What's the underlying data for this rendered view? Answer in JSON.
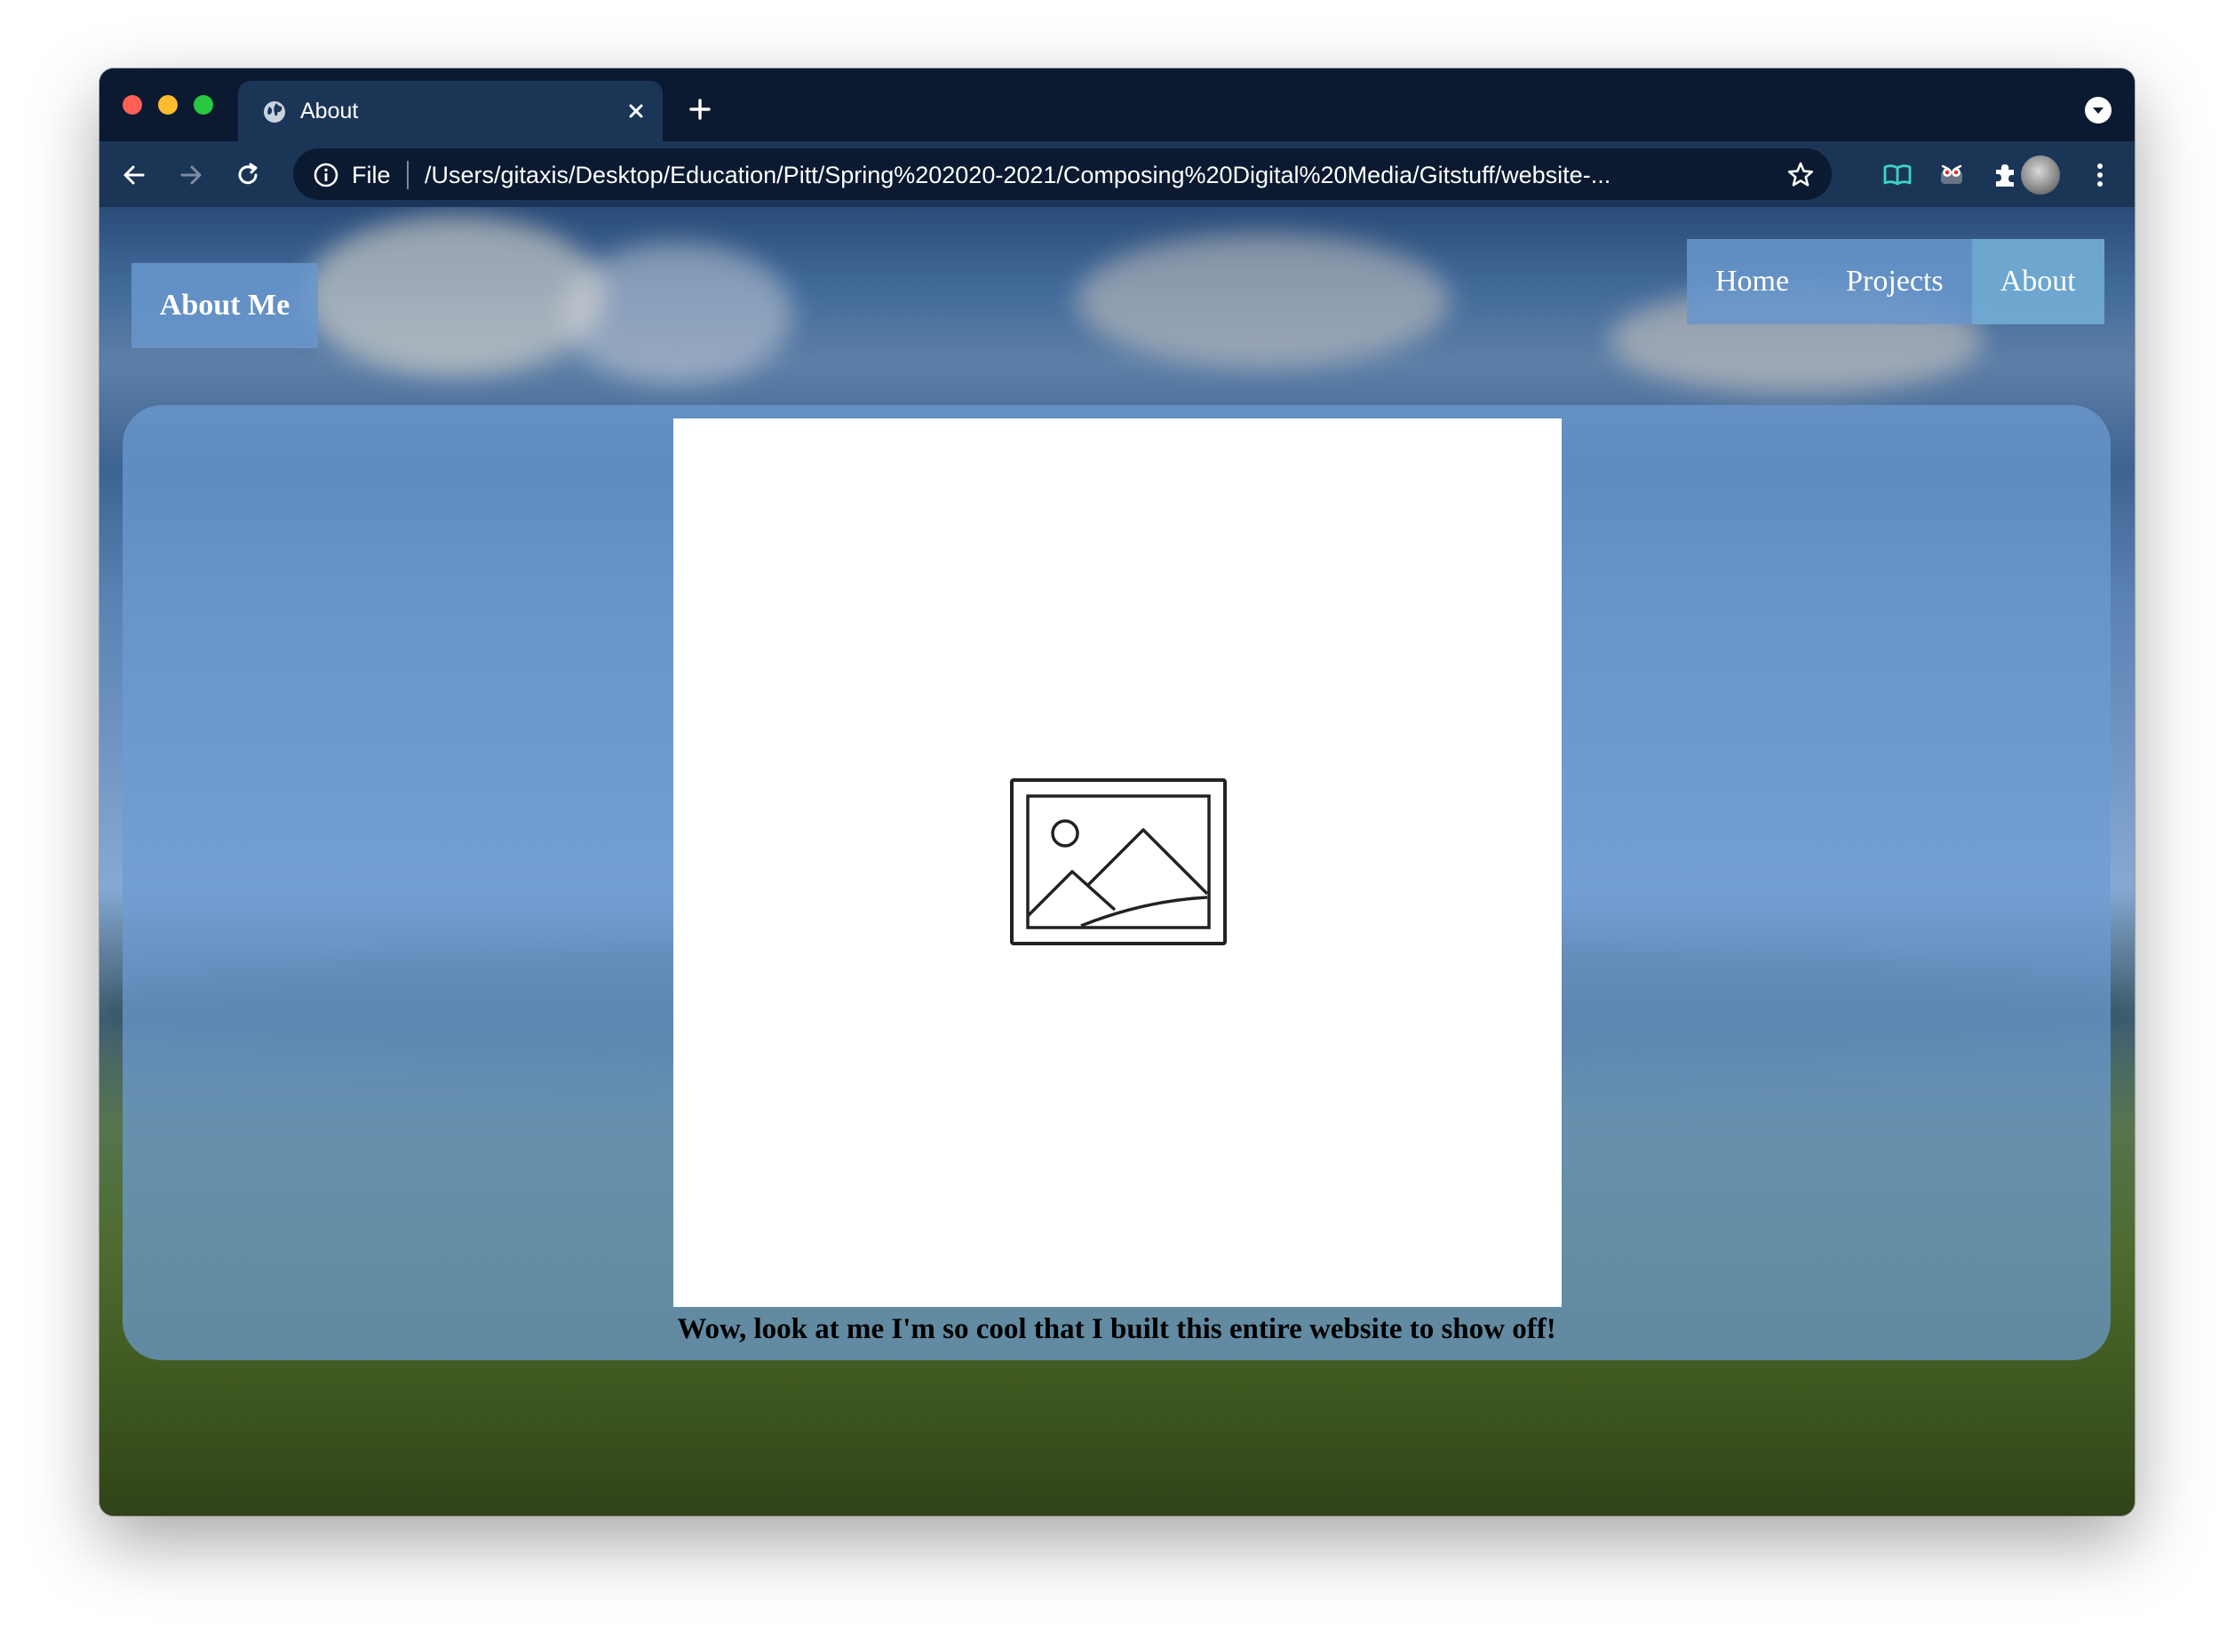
{
  "browser": {
    "tab": {
      "title": "About"
    },
    "address_bar": {
      "scheme_label": "File",
      "url": "/Users/gitaxis/Desktop/Education/Pitt/Spring%202020-2021/Composing%20Digital%20Media/Gitstuff/website-..."
    }
  },
  "page": {
    "site_title": "About Me",
    "nav": [
      {
        "label": "Home",
        "active": false
      },
      {
        "label": "Projects",
        "active": false
      },
      {
        "label": "About",
        "active": true
      }
    ],
    "caption": "Wow, look at me I'm so cool that I built this entire website to show off!"
  },
  "colors": {
    "browser_frame": "#0b1a31",
    "toolbar": "#1b3557",
    "nav_background": "#6896cd",
    "nav_active": "#70aad2",
    "panel": "#6e9bd2"
  },
  "icons": {
    "tab": "globe-icon",
    "image_placeholder": "broken-image-icon"
  }
}
